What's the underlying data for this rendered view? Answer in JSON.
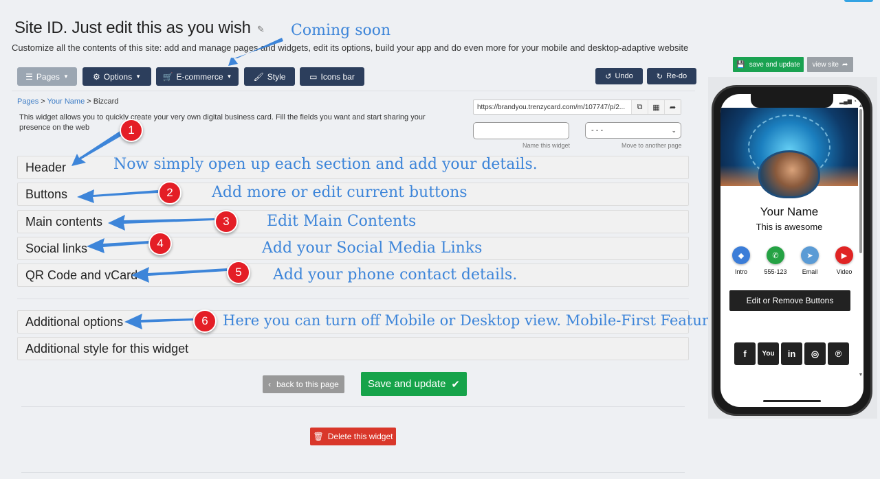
{
  "page": {
    "title": "Site ID. Just edit this as you wish",
    "subtitle": "Customize all the contents of this site: add and manage pages and widgets, edit its options, build your app and do even more for your mobile and desktop-adaptive website"
  },
  "toolbar": {
    "pages": "Pages",
    "options": "Options",
    "ecommerce": "E-commerce",
    "style": "Style",
    "icons_bar": "Icons bar",
    "undo": "Undo",
    "redo": "Re-do"
  },
  "breadcrumb": {
    "pages": "Pages",
    "your_name": "Your Name",
    "current": "Bizcard",
    "separator": ">"
  },
  "widget": {
    "description": "This widget allows you to quickly create your very own digital business card. Fill the fields you want and start sharing your presence on the web",
    "url": "https://brandyou.trenzycard.com/m/107747/p/2...",
    "name_caption": "Name this widget",
    "move_value": "- - -",
    "move_caption": "Move to another page"
  },
  "sections": {
    "header": "Header",
    "buttons": "Buttons",
    "main_contents": "Main contents",
    "social_links": "Social links",
    "qr_vcard": "QR Code and vCard",
    "additional_options": "Additional options",
    "additional_style": "Additional style for this widget"
  },
  "annotations": {
    "coming_soon": "Coming soon",
    "a1": "Now simply open up each section and add your details.",
    "a2": "Add more or edit current buttons",
    "a3": "Edit Main Contents",
    "a4": "Add your Social Media Links",
    "a5": "Add your phone contact details.",
    "a6": "Here you can turn off Mobile or Desktop view. Mobile-First Feature",
    "badges": [
      "1",
      "2",
      "3",
      "4",
      "5",
      "6"
    ]
  },
  "actions": {
    "back": "back to this page",
    "save": "Save and update",
    "delete": "Delete this widget"
  },
  "preview": {
    "save_update": "save and update",
    "view_site": "view site",
    "name": "Your Name",
    "tagline": "This is awesome",
    "apps": [
      {
        "label": "Intro",
        "icon": "intro-icon",
        "color": "#3b7dd8"
      },
      {
        "label": "555-123",
        "icon": "whatsapp-icon",
        "color": "#25a244"
      },
      {
        "label": "Email",
        "icon": "telegram-icon",
        "color": "#5b9bd5"
      },
      {
        "label": "Video",
        "icon": "youtube-icon",
        "color": "#e02424"
      }
    ],
    "edit_buttons": "Edit or Remove Buttons",
    "social_icons": [
      "facebook-icon",
      "youtube-icon",
      "linkedin-icon",
      "instagram-icon",
      "pinterest-icon"
    ]
  },
  "colors": {
    "primary_dark": "#2c3e5c",
    "success": "#16a34a",
    "danger": "#d9372a",
    "annotation": "#3d85d9",
    "badge": "#e41e26"
  }
}
